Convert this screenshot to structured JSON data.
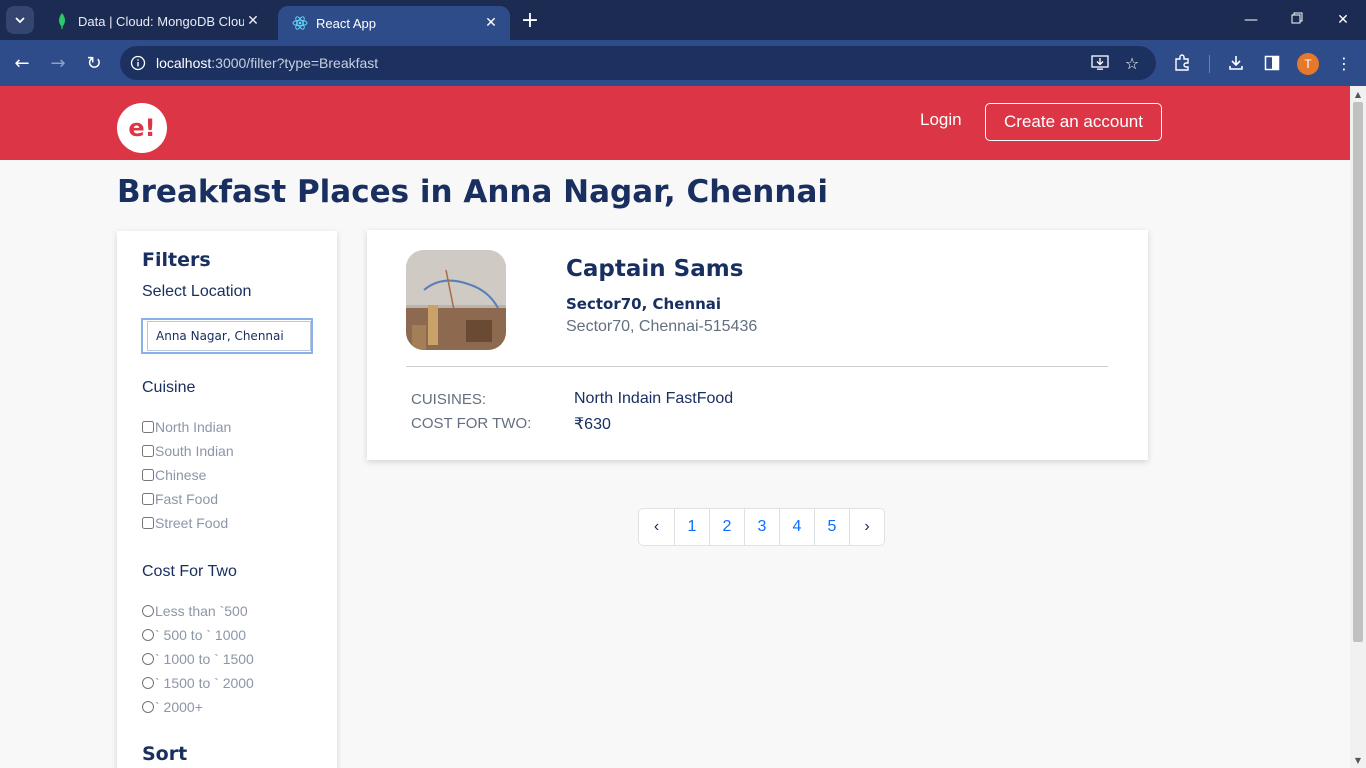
{
  "browser": {
    "tabs": [
      {
        "title": "Data | Cloud: MongoDB Cloud",
        "icon": "mongodb-leaf-icon",
        "active": false
      },
      {
        "title": "React App",
        "icon": "react-icon",
        "active": true
      }
    ],
    "url": {
      "host": "localhost",
      "rest": ":3000/filter?type=Breakfast"
    },
    "profile_initial": "T"
  },
  "header": {
    "logo_text": "e!",
    "login_label": "Login",
    "create_account_label": "Create an account",
    "color": "#dc3545"
  },
  "page_title": "Breakfast Places in Anna Nagar, Chennai",
  "filters": {
    "title": "Filters",
    "location_label": "Select Location",
    "location_value": "Anna Nagar, Chennai",
    "cuisine_label": "Cuisine",
    "cuisines": [
      "North Indian",
      "South Indian",
      "Chinese",
      "Fast Food",
      "Street Food"
    ],
    "cost_label": "Cost For Two",
    "costs": [
      "Less than `500",
      "` 500 to ` 1000",
      "` 1000 to ` 1500",
      "` 1500 to ` 2000",
      "` 2000+"
    ],
    "sort_label": "Sort"
  },
  "restaurant": {
    "name": "Captain Sams",
    "locality": "Sector70, Chennai",
    "address": "Sector70, Chennai-515436",
    "cuisines_key": "CUISINES:",
    "cuisines_value": "North Indain FastFood",
    "cost_key": "COST FOR TWO:",
    "cost_value": "₹630"
  },
  "pagination": {
    "prev": "‹",
    "pages": [
      "1",
      "2",
      "3",
      "4",
      "5"
    ],
    "next": "›"
  },
  "colors": {
    "title": "#192f60",
    "accent": "#dc3545",
    "link": "#0d6efd"
  }
}
